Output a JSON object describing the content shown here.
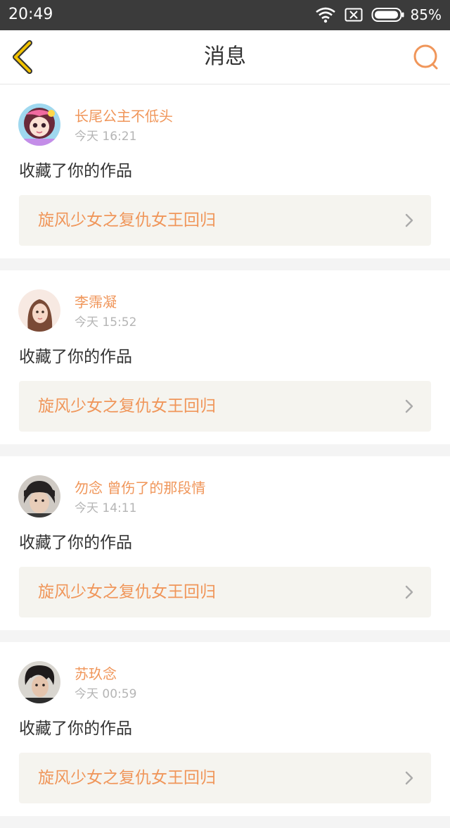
{
  "status_bar": {
    "time": "20:49",
    "battery": "85%"
  },
  "nav": {
    "title": "消息"
  },
  "colors": {
    "accent": "#f0965a",
    "nav_back": "#f2c200",
    "status_bg": "#3b3b3b"
  },
  "messages": [
    {
      "user": "长尾公主不低头",
      "time": "今天 16:21",
      "action": "收藏了你的作品",
      "work_title": "旋风少女之复仇女王回归"
    },
    {
      "user": "李霈凝",
      "time": "今天 15:52",
      "action": "收藏了你的作品",
      "work_title": "旋风少女之复仇女王回归"
    },
    {
      "user": "勿念 曾伤了的那段情",
      "time": "今天 14:11",
      "action": "收藏了你的作品",
      "work_title": "旋风少女之复仇女王回归"
    },
    {
      "user": "苏玖念",
      "time": "今天 00:59",
      "action": "收藏了你的作品",
      "work_title": "旋风少女之复仇女王回归"
    }
  ]
}
